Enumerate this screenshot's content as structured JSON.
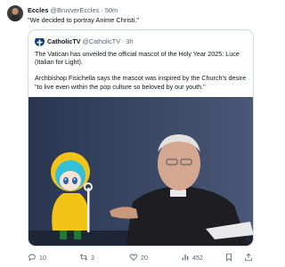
{
  "tweet": {
    "author_name": "Eccles",
    "author_handle": "@BruvverEccles",
    "separator": "·",
    "time": "50m",
    "text": "\"We decided to portray Anime Christi.\""
  },
  "quote": {
    "author_name": "CatholicTV",
    "author_handle": "@CatholicTV",
    "separator": "·",
    "time": "3h",
    "paragraph1": "The Vatican has unveiled the official mascot of the Holy Year 2025: Luce (Italian for Light).",
    "paragraph2": "Archbishop Fisichella says the mascot was inspired by the Church's desire \"to live even within the pop culture so beloved by our youth.\""
  },
  "actions": {
    "replies": "10",
    "reposts": "3",
    "likes": "20",
    "views": "452"
  },
  "colors": {
    "text": "#0f1419",
    "secondary": "#536471",
    "border": "#cfd9de",
    "mascot_coat": "#f2c418",
    "mascot_hair": "#33bfd6"
  }
}
